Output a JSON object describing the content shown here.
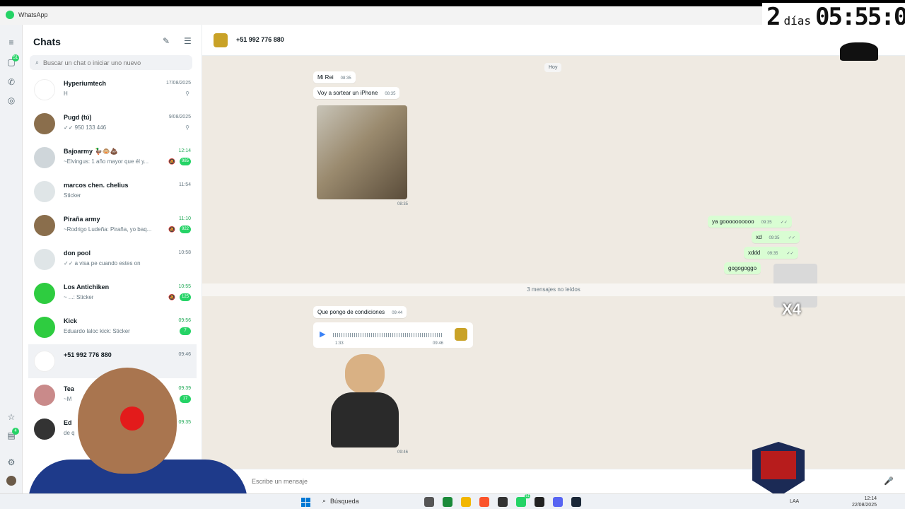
{
  "window": {
    "app_name": "WhatsApp"
  },
  "timer": {
    "days": "2",
    "days_label": "días",
    "clock": "05:55:0"
  },
  "sidebar": {
    "title": "Chats",
    "search_placeholder": "Buscar un chat o iniciar uno nuevo",
    "rail_badges": {
      "chats": "51",
      "status": "4"
    },
    "chats": [
      {
        "name": "Hyperiumtech",
        "time": "17/08/2025",
        "preview": "H",
        "pinned": true
      },
      {
        "name": "Pugd (tú)",
        "time": "9/08/2025",
        "preview": "✓✓ 950 133 446",
        "pinned": true
      },
      {
        "name": "Bajoarmy 🦆🐵💩",
        "time": "12:14",
        "preview": "~Elvingus: 1 año mayor que él y...",
        "badge": "985",
        "muted": true,
        "unread": true
      },
      {
        "name": "marcos chen. chelius",
        "time": "11:54",
        "preview": "Sticker"
      },
      {
        "name": "Piraña army",
        "time": "11:10",
        "preview": "~Rodrigo Ludeña: Piraña, yo baq...",
        "badge": "922",
        "muted": true,
        "unread": true
      },
      {
        "name": "don pool",
        "time": "10:58",
        "preview": "✓✓ a visa pe cuando estes on"
      },
      {
        "name": "Los Antichiken",
        "time": "10:55",
        "preview": "~ ...: Sticker",
        "badge": "125",
        "muted": true,
        "unread": true
      },
      {
        "name": "Kick",
        "time": "09:56",
        "preview": "Eduardo laloc kick: Sticker",
        "badge": "7",
        "unread": true
      },
      {
        "name": "+51 992 776 880",
        "time": "09:46",
        "preview": ""
      },
      {
        "name": "Tea",
        "time": "09:39",
        "preview": "~M",
        "badge": "17",
        "unread": true
      },
      {
        "name": "Ed",
        "time": "09:35",
        "preview": "de q",
        "unread": true
      }
    ]
  },
  "conversation": {
    "contact": "+51 992 776 880",
    "date_chip": "Hoy",
    "messages": [
      {
        "dir": "in",
        "text": "Mi Rei",
        "time": "08:35"
      },
      {
        "dir": "in",
        "text": "Voy a sortear un iPhone",
        "time": "08:35"
      },
      {
        "dir": "in",
        "type": "image",
        "time": "08:35"
      },
      {
        "dir": "out",
        "text": "ya goooooooooo",
        "time": "09:35"
      },
      {
        "dir": "out",
        "text": "xd",
        "time": "09:35"
      },
      {
        "dir": "out",
        "text": "xddd",
        "time": "09:35"
      },
      {
        "dir": "out",
        "text": "gogogoggo",
        "time": ""
      },
      {
        "dir": "in",
        "text": "Que pongo de condiciones",
        "time": "09:44"
      },
      {
        "dir": "in",
        "type": "voice",
        "duration": "1:33",
        "time": "09:46"
      },
      {
        "dir": "in",
        "type": "sticker",
        "time": "09:46"
      }
    ],
    "unread_divider": "3 mensajes no leídos",
    "sticker_overlay": "X4"
  },
  "composer": {
    "placeholder": "Escribe un mensaje"
  },
  "taskbar": {
    "search_label": "Búsqueda",
    "lang": "LAA",
    "time": "12:14",
    "date": "22/08/2025",
    "whatsapp_badge": "51"
  },
  "colors": {
    "accent": "#25d366",
    "outgoing_bubble": "#d9fdd3",
    "chat_bg": "#efeae2"
  }
}
